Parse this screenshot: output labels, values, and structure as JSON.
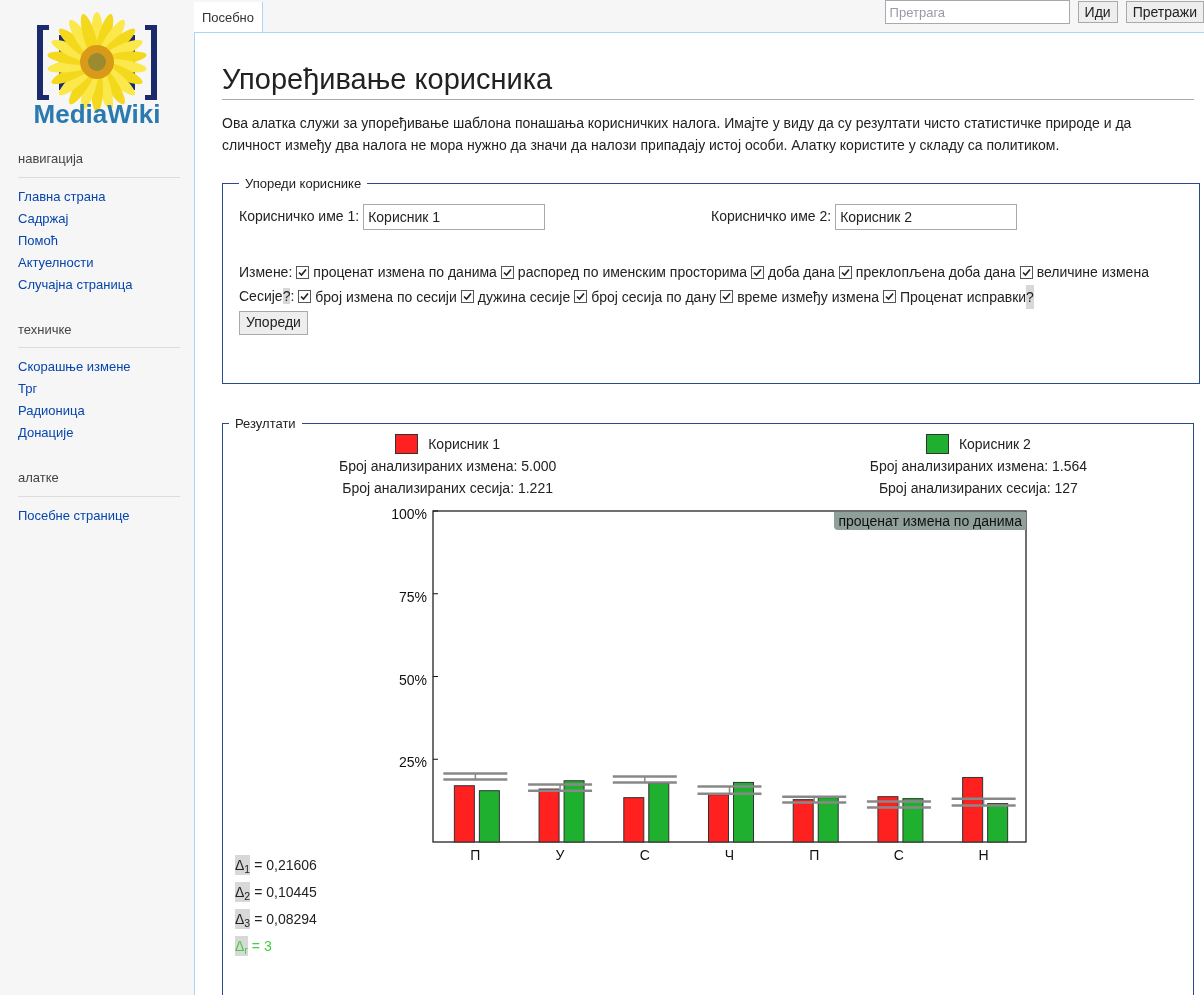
{
  "logo": {
    "text": "MediaWiki"
  },
  "sidebar": {
    "sections": [
      {
        "heading": "навигација",
        "items": [
          {
            "label": "Главна страна"
          },
          {
            "label": "Садржај"
          },
          {
            "label": "Помоћ"
          },
          {
            "label": "Актуелности"
          },
          {
            "label": "Случајна страница"
          }
        ]
      },
      {
        "heading": "техничке",
        "items": [
          {
            "label": "Скорашње измене"
          },
          {
            "label": "Трг"
          },
          {
            "label": "Радионица"
          },
          {
            "label": "Донације"
          }
        ]
      },
      {
        "heading": "алатке",
        "items": [
          {
            "label": "Посебне странице"
          }
        ]
      }
    ]
  },
  "tabs": [
    {
      "label": "Посебно",
      "selected": true
    }
  ],
  "search": {
    "placeholder": "Претрага",
    "buttons": [
      "Иди",
      "Претражи"
    ]
  },
  "title": "Упоређивање корисника",
  "intro": "Ова алатка служи за упоређивање шаблона понашања корисничких налога. Имајте у виду да су резултати чисто статистичке природе и да сличност између два налога не мора нужно да значи да налози припадају истој особи. Алатку користите у складу са политиком.",
  "compare_form": {
    "legend": "Упореди кориснике",
    "fields": [
      {
        "label": "Корисничко име 1:",
        "value": "Корисник 1"
      },
      {
        "label": "Корисничко име 2:",
        "value": "Корисник 2"
      }
    ],
    "groups": [
      {
        "label": "Измене",
        "label_end": ":",
        "items": [
          {
            "label": "проценат измена по данима",
            "checked": true
          },
          {
            "label": "распоред по именским просторима",
            "checked": true
          },
          {
            "label": "доба дана",
            "checked": true
          },
          {
            "label": "преклопљена доба дана",
            "checked": true
          },
          {
            "label": "величине измена",
            "checked": true
          }
        ]
      },
      {
        "label": "Сесије",
        "help": "?",
        "label_end": ":",
        "items": [
          {
            "label": "број измена по сесији",
            "checked": true
          },
          {
            "label": "дужина сесије",
            "checked": true
          },
          {
            "label": "број сесија по дану",
            "checked": true
          },
          {
            "label": "време између измена",
            "checked": true
          },
          {
            "label": "Проценат исправки",
            "help": "?",
            "checked": true
          }
        ]
      }
    ],
    "submit": "Упореди"
  },
  "results": {
    "legend": "Резултати",
    "users": [
      {
        "edits": "Број анализираних измена: 5.000",
        "sessions": "Број анализираних сесија: 1.221"
      },
      {
        "edits": "Број анализираних измена: 1.564",
        "sessions": "Број анализираних сесија: 127"
      }
    ],
    "chart_data": {
      "type": "bar",
      "title": "проценат измена по данима",
      "categories": [
        "П",
        "У",
        "С",
        "Ч",
        "П",
        "С",
        "Н"
      ],
      "series": [
        {
          "name": "Корисник 1",
          "color": "#ff2020",
          "values": [
            17.0,
            16.0,
            13.4,
            14.3,
            12.8,
            13.7,
            19.5
          ]
        },
        {
          "name": "Корисник 2",
          "color": "#20b030",
          "values": [
            15.5,
            18.5,
            17.7,
            18.0,
            13.4,
            13.1,
            11.6
          ]
        }
      ],
      "ylim": [
        0,
        100
      ],
      "yticks": [
        {
          "value": 25,
          "label": "25%"
        },
        {
          "value": 50,
          "label": "50%"
        },
        {
          "value": 75,
          "label": "75%"
        },
        {
          "value": 100,
          "label": "100%"
        }
      ]
    },
    "deltas": [
      {
        "symbol": "Δ$_{1}$",
        "value": "= 0,21606",
        "color": "#222222"
      },
      {
        "symbol": "Δ$_{2}$",
        "value": "= 0,10445",
        "color": "#222222"
      },
      {
        "symbol": "Δ$_{3}$",
        "value": "= 0,08294",
        "color": "#222222"
      },
      {
        "symbol": "Δ$_{r}$",
        "value": "= 3",
        "color": "#44cc44"
      }
    ]
  }
}
